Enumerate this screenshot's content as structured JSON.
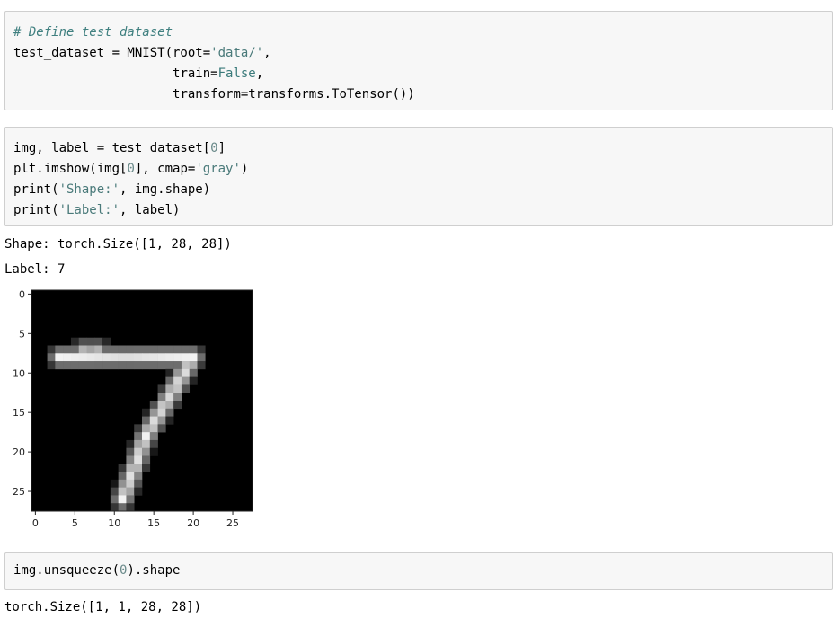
{
  "cell1": {
    "comment": "# Define test dataset",
    "l1_a": "test_dataset = MNIST(root=",
    "l1_str": "'data/'",
    "l1_b": ",",
    "l2_indent": "                     ",
    "l2_a": "train=",
    "l2_kw": "False",
    "l2_b": ",",
    "l3_indent": "                     ",
    "l3_a": "transform=transforms.ToTensor())"
  },
  "cell2": {
    "l1_a": "img, label = test_dataset[",
    "l1_num": "0",
    "l1_b": "]",
    "l2_a": "plt.imshow(img[",
    "l2_num": "0",
    "l2_b": "], cmap=",
    "l2_str": "'gray'",
    "l2_c": ")",
    "l3_a": "print(",
    "l3_str": "'Shape:'",
    "l3_b": ", img.shape)",
    "l4_a": "print(",
    "l4_str": "'Label:'",
    "l4_b": ", label)"
  },
  "output2": {
    "shape_line": "Shape: torch.Size([1, 28, 28])",
    "label_line": "Label: 7"
  },
  "plot": {
    "xticks": [
      "0",
      "5",
      "10",
      "15",
      "20",
      "25"
    ],
    "yticks": [
      "0",
      "5",
      "10",
      "15",
      "20",
      "25"
    ],
    "image_size": 28,
    "cmap": "gray",
    "strokes": [
      {
        "from": [
          3,
          8
        ],
        "to": [
          20,
          8
        ],
        "v": 0.95
      },
      {
        "from": [
          6,
          7
        ],
        "to": [
          8,
          7
        ],
        "v": 0.7
      },
      {
        "from": [
          20,
          8
        ],
        "to": [
          14,
          18
        ],
        "v": 0.95
      },
      {
        "from": [
          14,
          18
        ],
        "to": [
          11,
          26
        ],
        "v": 0.95
      }
    ]
  },
  "cell3": {
    "l1_a": "img.unsqueeze(",
    "l1_num": "0",
    "l1_b": ").shape"
  },
  "output3": {
    "line": "torch.Size([1, 1, 28, 28])"
  }
}
